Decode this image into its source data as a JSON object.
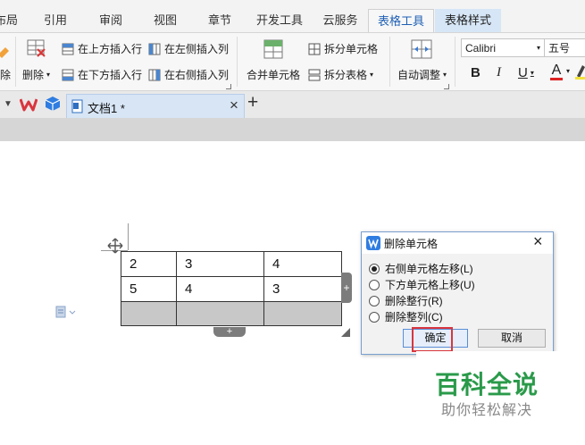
{
  "ribbon_tabs": [
    {
      "label": "布局"
    },
    {
      "label": "引用"
    },
    {
      "label": "审阅"
    },
    {
      "label": "视图"
    },
    {
      "label": "章节"
    },
    {
      "label": "开发工具"
    },
    {
      "label": "云服务"
    },
    {
      "label": "表格工具"
    },
    {
      "label": "表格样式"
    }
  ],
  "ribbon": {
    "partial_left_label": "除",
    "delete_label": "删除",
    "insert_above": "在上方插入行",
    "insert_below": "在下方插入行",
    "insert_left": "在左侧插入列",
    "insert_right": "在右侧插入列",
    "merge_cells": "合并单元格",
    "split_cells": "拆分单元格",
    "split_table": "拆分表格",
    "auto_fit": "自动调整",
    "font_name": "Calibri",
    "font_size": "五号",
    "bold": "B",
    "italic": "I",
    "underline": "U",
    "font_color_letter": "A"
  },
  "doc_tab": {
    "title": "文档1 *",
    "close": "×",
    "new_tab": "+"
  },
  "table": {
    "rows": [
      [
        "2",
        "3",
        "4"
      ],
      [
        "5",
        "4",
        "3"
      ],
      [
        "",
        "",
        ""
      ]
    ]
  },
  "dialog": {
    "title": "删除单元格",
    "close": "×",
    "options": [
      {
        "label": "右侧单元格左移(L)",
        "checked": true
      },
      {
        "label": "下方单元格上移(U)",
        "checked": false
      },
      {
        "label": "删除整行(R)",
        "checked": false
      },
      {
        "label": "删除整列(C)",
        "checked": false
      }
    ],
    "ok": "确定",
    "cancel": "取消"
  },
  "watermark": {
    "title": "百科全说",
    "subtitle": "助你轻松解决"
  },
  "colors": {
    "accent": "#1e5fb4",
    "context_tab": "#d6e6f7",
    "watermark_green": "#2a9a4a",
    "highlight_red": "#d9363e"
  }
}
